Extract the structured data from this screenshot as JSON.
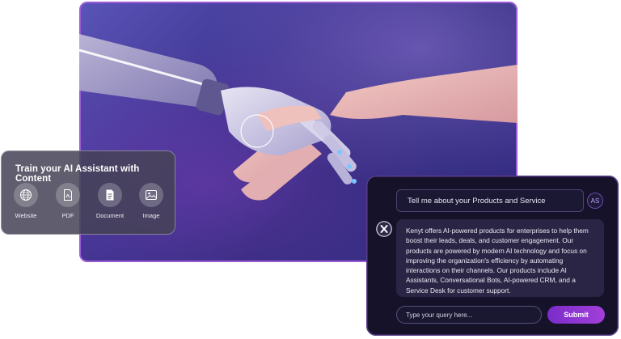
{
  "train": {
    "title": "Train your AI Assistant with Content",
    "sources": [
      {
        "label": "Website",
        "icon": "globe-icon"
      },
      {
        "label": "PDF",
        "icon": "pdf-icon"
      },
      {
        "label": "Document",
        "icon": "document-icon"
      },
      {
        "label": "Image",
        "icon": "image-icon"
      }
    ]
  },
  "chat": {
    "user_message": "Tell me about your Products and Service",
    "user_initials": "AS",
    "bot_reply": "Kenyt offers AI-powered products for enterprises to help them boost their leads, deals, and customer engagement. Our products are powered by modern AI technology and focus on improving the organization's efficiency by automating interactions on their channels. Our products include AI Assistants, Conversational Bots, AI-powered CRM, and a Service Desk for customer support.",
    "input_placeholder": "Type your query here...",
    "submit_label": "Submit"
  },
  "colors": {
    "accent": "#9a3fd6",
    "panel_dark": "#15122a",
    "bubble": "#2a2544"
  }
}
